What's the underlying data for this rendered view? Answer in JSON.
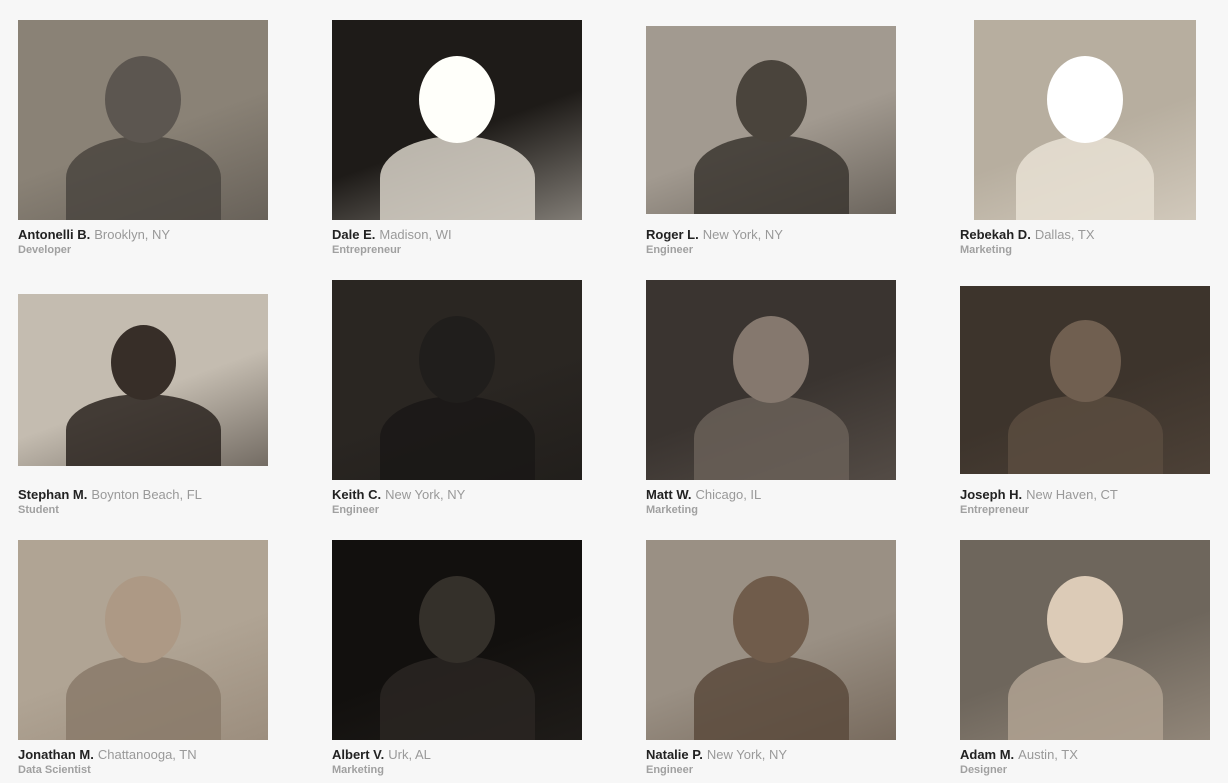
{
  "people": [
    {
      "name": "Antonelli B.",
      "location": "Brooklyn, NY",
      "role": "Developer",
      "tone": "#4a4540",
      "bg": "#8a8276",
      "photo_w": 250,
      "photo_h": 200
    },
    {
      "name": "Dale E.",
      "location": "Madison, WI",
      "role": "Entrepreneur",
      "tone": "#d8d2c8",
      "bg": "#1e1b18",
      "photo_w": 250,
      "photo_h": 200
    },
    {
      "name": "Roger L.",
      "location": "New York, NY",
      "role": "Engineer",
      "tone": "#3b3630",
      "bg": "#a29a90",
      "photo_w": 250,
      "photo_h": 188
    },
    {
      "name": "Rebekah D.",
      "location": "Dallas, TX",
      "role": "Marketing",
      "tone": "#e8e0d4",
      "bg": "#b7ae9f",
      "photo_w": 222,
      "photo_h": 200
    },
    {
      "name": "Stephan M.",
      "location": "Boynton Beach, FL",
      "role": "Student",
      "tone": "#2c2520",
      "bg": "#c4bcb0",
      "photo_w": 250,
      "photo_h": 172
    },
    {
      "name": "Keith C.",
      "location": "New York, NY",
      "role": "Engineer",
      "tone": "#1a1816",
      "bg": "#2a2622",
      "photo_w": 250,
      "photo_h": 200
    },
    {
      "name": "Matt W.",
      "location": "Chicago, IL",
      "role": "Marketing",
      "tone": "#6a6058",
      "bg": "#3a3430",
      "photo_w": 250,
      "photo_h": 200
    },
    {
      "name": "Joseph H.",
      "location": "New Haven, CT",
      "role": "Entrepreneur",
      "tone": "#5a4c40",
      "bg": "#3d342c",
      "photo_w": 250,
      "photo_h": 188
    },
    {
      "name": "Jonathan M.",
      "location": "Chattanooga, TN",
      "role": "Data Scientist",
      "tone": "#8a7a6a",
      "bg": "#b0a494",
      "photo_w": 250,
      "photo_h": 200
    },
    {
      "name": "Albert V.",
      "location": "Urk, AL",
      "role": "Marketing",
      "tone": "#2a2622",
      "bg": "#12100e",
      "photo_w": 250,
      "photo_h": 200
    },
    {
      "name": "Natalie P.",
      "location": "New York, NY",
      "role": "Engineer",
      "tone": "#5a4a3c",
      "bg": "#9a9084",
      "photo_w": 250,
      "photo_h": 200
    },
    {
      "name": "Adam M.",
      "location": "Austin, TX",
      "role": "Designer",
      "tone": "#b0a292",
      "bg": "#6e665c",
      "photo_w": 250,
      "photo_h": 200
    }
  ],
  "colors": {
    "page_bg": "#f7f7f7",
    "name": "#222222",
    "location": "#999999",
    "role": "#a0a0a0"
  }
}
